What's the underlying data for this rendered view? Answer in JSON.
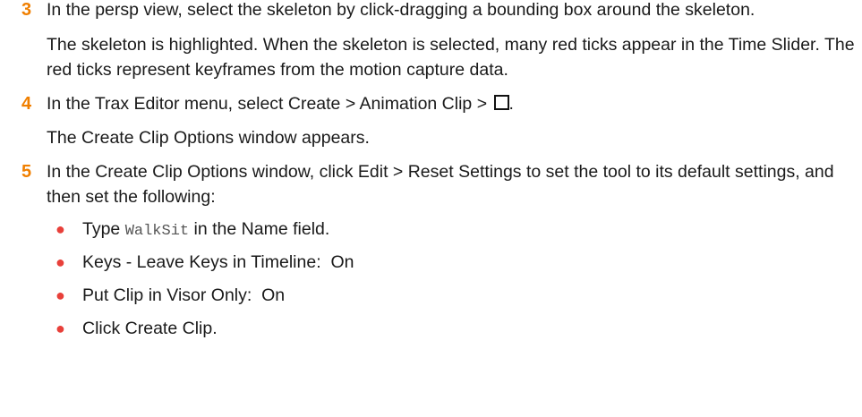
{
  "steps": [
    {
      "number": "3",
      "text": "In the persp view, select the skeleton by click-dragging a bounding box around the skeleton.",
      "result": "The skeleton is highlighted. When the skeleton is selected, many red ticks appear in the Time Slider. The red ticks represent keyframes from the motion capture data."
    },
    {
      "number": "4",
      "text_before_icon": "In the Trax Editor menu, select Create > Animation Clip > ",
      "text_after_icon": ".",
      "icon": "option-box-icon",
      "result": "The Create Clip Options window appears."
    },
    {
      "number": "5",
      "text": "In the Create Clip Options window, click Edit > Reset Settings to set the tool to its default settings, and then set the following:",
      "bullets": [
        {
          "pre": "Type ",
          "code": "WalkSit",
          "post": " in the Name field."
        },
        {
          "pre": "Keys - Leave Keys in Timeline:  On"
        },
        {
          "pre": "Put Clip in Visor Only:  On"
        },
        {
          "pre": "Click Create Clip."
        }
      ]
    }
  ],
  "colors": {
    "step_number": "#f07f00",
    "bullet": "#e8403a",
    "text": "#1a1a1a"
  }
}
